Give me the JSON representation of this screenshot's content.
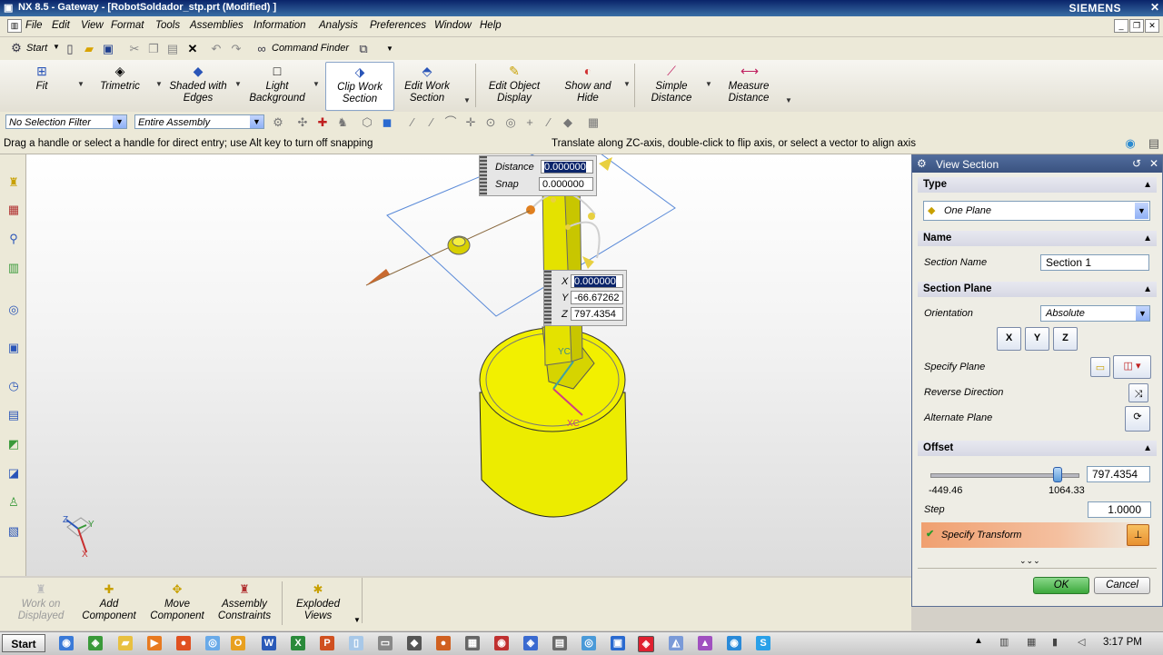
{
  "window": {
    "title": "NX 8.5 - Gateway - [RobotSoldador_stp.prt (Modified) ]",
    "brand": "SIEMENS"
  },
  "menubar": {
    "items": [
      "File",
      "Edit",
      "View",
      "Format",
      "Tools",
      "Assemblies",
      "Information",
      "Analysis",
      "Preferences",
      "Window",
      "Help"
    ]
  },
  "commandrow": {
    "start": "Start",
    "command_finder": "Command Finder"
  },
  "ribbon": {
    "fit": "Fit",
    "trimetric": "Trimetric",
    "shaded_l1": "Shaded with",
    "shaded_l2": "Edges",
    "light_l1": "Light",
    "light_l2": "Background",
    "clip_l1": "Clip Work",
    "clip_l2": "Section",
    "edit_l1": "Edit Work",
    "edit_l2": "Section",
    "editobj_l1": "Edit Object",
    "editobj_l2": "Display",
    "show_l1": "Show and",
    "show_l2": "Hide",
    "simple_l1": "Simple",
    "simple_l2": "Distance",
    "measure_l1": "Measure",
    "measure_l2": "Distance"
  },
  "selection": {
    "filter": "No Selection Filter",
    "scope": "Entire Assembly"
  },
  "status": {
    "left": "Drag a handle or select a handle for direct entry; use Alt key to turn off snapping",
    "right": "Translate along ZC-axis, double-click to flip axis, or select a vector to align axis"
  },
  "viewport": {
    "distance_label": "Distance",
    "distance_value": "0.000000",
    "snap_label": "Snap",
    "snap_value": "0.000000",
    "x_label": "X",
    "x_value": "0.000000",
    "y_label": "Y",
    "y_value": "-66.67262",
    "z_label": "Z",
    "z_value": "797.4354",
    "axis_xc": "XC",
    "axis_yc": "YC",
    "triad_z": "Z",
    "triad_y": "Y",
    "triad_x": "X"
  },
  "dialog": {
    "title": "View Section",
    "type_group": "Type",
    "type_value": "One Plane",
    "name_group": "Name",
    "section_name_label": "Section Name",
    "section_name_value": "Section 1",
    "plane_group": "Section Plane",
    "orientation_label": "Orientation",
    "orientation_value": "Absolute",
    "axis_x": "X",
    "axis_y": "Y",
    "axis_z": "Z",
    "specify_plane": "Specify Plane",
    "reverse_direction": "Reverse Direction",
    "alternate_plane": "Alternate Plane",
    "offset_group": "Offset",
    "offset_value": "797.4354",
    "slider_min": "-449.46",
    "slider_max": "1064.33",
    "slider_position": 0.86,
    "step_label": "Step",
    "step_value": "1.0000",
    "specify_transform": "Specify Transform",
    "ok": "OK",
    "cancel": "Cancel"
  },
  "assembly_bar": {
    "work_l1": "Work on",
    "work_l2": "Displayed",
    "add_l1": "Add",
    "add_l2": "Component",
    "move_l1": "Move",
    "move_l2": "Component",
    "asm_l1": "Assembly",
    "asm_l2": "Constraints",
    "exploded_l1": "Exploded",
    "exploded_l2": "Views"
  },
  "taskbar": {
    "start": "Start",
    "time": "3:17 PM"
  },
  "colors": {
    "model_yellow": "#f2f000",
    "selection_blue": "#0a246a",
    "titlebar": "#0a246a",
    "ok_green": "#4bb84b"
  }
}
